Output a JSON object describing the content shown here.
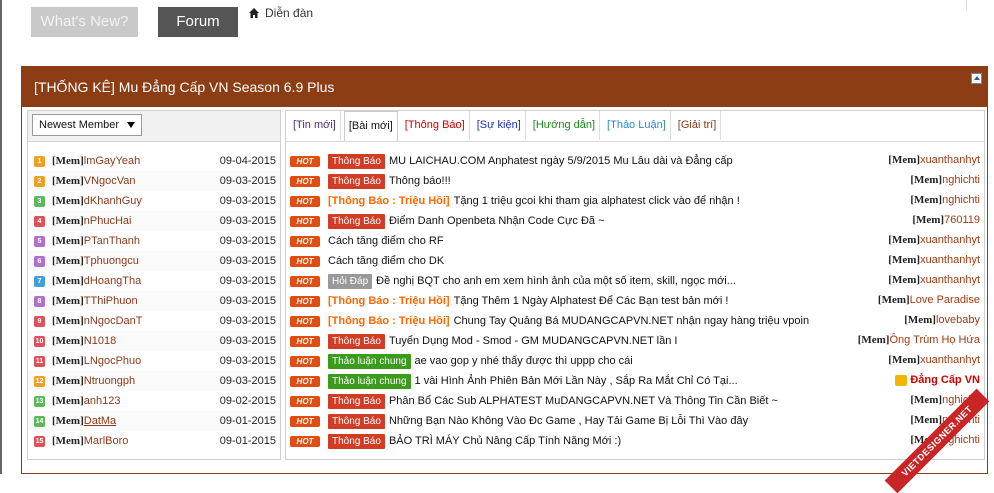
{
  "nav": {
    "whats_new": "What's New?",
    "forum": "Forum",
    "breadcrumb": "Diễn đàn"
  },
  "panel": {
    "title": "[THỐNG KÊ] Mu Đẳng Cấp VN Season 6.9 Plus"
  },
  "member_select": {
    "selected": "Newest Member"
  },
  "tabs": [
    {
      "label": "[Tin mới]",
      "color": "#5a2a7a"
    },
    {
      "label": "[Bài mới]",
      "color": "#111111"
    },
    {
      "label": "[Thông Báo]",
      "color": "#cc0000"
    },
    {
      "label": "[Sự kiện]",
      "color": "#1a2fb5"
    },
    {
      "label": "[Hướng dẫn]",
      "color": "#1a8a1a"
    },
    {
      "label": "[Thảo Luận]",
      "color": "#2a8ad8"
    },
    {
      "label": "[Giải trí]",
      "color": "#8b3a1a"
    }
  ],
  "members": [
    {
      "rank": "1",
      "rank_color": "#f0a020",
      "tag": "[Mem]",
      "name": "lmGayYeah",
      "date": "09-04-2015"
    },
    {
      "rank": "2",
      "rank_color": "#f0a020",
      "tag": "[Mem]",
      "name": "VNgocVan",
      "date": "09-03-2015"
    },
    {
      "rank": "3",
      "rank_color": "#5cb85c",
      "tag": "[Mem]",
      "name": "dKhanhGuy",
      "date": "09-03-2015"
    },
    {
      "rank": "4",
      "rank_color": "#e0505a",
      "tag": "[Mem]",
      "name": "nPhucHai",
      "date": "09-03-2015"
    },
    {
      "rank": "5",
      "rank_color": "#b070d0",
      "tag": "[Mem]",
      "name": "PTanThanh",
      "date": "09-03-2015"
    },
    {
      "rank": "6",
      "rank_color": "#b070d0",
      "tag": "[Mem]",
      "name": "Tphuongcu",
      "date": "09-03-2015"
    },
    {
      "rank": "7",
      "rank_color": "#40a0d8",
      "tag": "[Mem]",
      "name": "dHoangTha",
      "date": "09-03-2015"
    },
    {
      "rank": "8",
      "rank_color": "#b070d0",
      "tag": "[Mem]",
      "name": "TThiPhuon",
      "date": "09-03-2015"
    },
    {
      "rank": "9",
      "rank_color": "#e0505a",
      "tag": "[Mem]",
      "name": "nNgocDanT",
      "date": "09-03-2015"
    },
    {
      "rank": "10",
      "rank_color": "#e0505a",
      "tag": "[Mem]",
      "name": "N1018",
      "date": "09-03-2015"
    },
    {
      "rank": "11",
      "rank_color": "#e0505a",
      "tag": "[Mem]",
      "name": "LNgocPhuo",
      "date": "09-03-2015"
    },
    {
      "rank": "12",
      "rank_color": "#f0a020",
      "tag": "[Mem]",
      "name": "Ntruongph",
      "date": "09-03-2015"
    },
    {
      "rank": "13",
      "rank_color": "#5cb85c",
      "tag": "[Mem]",
      "name": "anh123",
      "date": "09-02-2015"
    },
    {
      "rank": "14",
      "rank_color": "#5cb85c",
      "tag": "[Mem]",
      "name": "DatMa",
      "date": "09-01-2015"
    },
    {
      "rank": "15",
      "rank_color": "#e0505a",
      "tag": "[Mem]",
      "name": "MarlBoro",
      "date": "09-01-2015"
    }
  ],
  "threads": [
    {
      "hot": "HOT",
      "badge": "Thông Báo",
      "badge_type": "bred",
      "prefix": "",
      "title": "MU LAICHAU.COM Anphatest ngày 5/9/2015 Mu Lâu dài và Đẳng cấp",
      "tag": "[Mem]",
      "user": "xuanthanhyt"
    },
    {
      "hot": "HOT",
      "badge": "Thông Báo",
      "badge_type": "bred",
      "prefix": "",
      "title": "Thông báo!!!",
      "tag": "[Mem]",
      "user": "nghichti"
    },
    {
      "hot": "HOT",
      "badge": "",
      "badge_type": "",
      "prefix": "[Thông Báo : Triệu Hồi]",
      "title": "Tặng 1 triệu gcoi khi tham gia alphatest click vào để nhận !",
      "tag": "[Mem]",
      "user": "nghichti"
    },
    {
      "hot": "HOT",
      "badge": "Thông Báo",
      "badge_type": "bred",
      "prefix": "",
      "title": "Điểm Danh Openbeta Nhận Code Cực Đã ~",
      "tag": "[Mem]",
      "user": "760119"
    },
    {
      "hot": "HOT",
      "badge": "",
      "badge_type": "",
      "prefix": "",
      "title": "Cách tăng điểm cho RF",
      "tag": "[Mem]",
      "user": "xuanthanhyt"
    },
    {
      "hot": "HOT",
      "badge": "",
      "badge_type": "",
      "prefix": "",
      "title": "Cách tăng điểm cho DK",
      "tag": "[Mem]",
      "user": "xuanthanhyt"
    },
    {
      "hot": "HOT",
      "badge": "Hỏi Đáp",
      "badge_type": "bgray",
      "prefix": "",
      "title": "Đề nghị BQT cho anh em xem hình ảnh của một số item, skill, ngọc mới...",
      "tag": "[Mem]",
      "user": "xuanthanhyt"
    },
    {
      "hot": "HOT",
      "badge": "",
      "badge_type": "",
      "prefix": "[Thông Báo : Triệu Hồi]",
      "title": "Tặng Thêm 1 Ngày Alphatest Để Các Bạn test bản mới !",
      "tag": "[Mem]",
      "user": "Love Paradise"
    },
    {
      "hot": "HOT",
      "badge": "",
      "badge_type": "",
      "prefix": "[Thông Báo : Triệu Hồi]",
      "title": "Chung Tay Quảng Bá MUDANGCAPVN.NET nhận ngay hàng triệu vpoin",
      "tag": "[Mem]",
      "user": "lovebaby"
    },
    {
      "hot": "HOT",
      "badge": "Thông Báo",
      "badge_type": "bred",
      "prefix": "",
      "title": "Tuyển Dụng Mod - Smod - GM MUDANGCAPVN.NET lần I",
      "tag": "[Mem]",
      "user": "Ông Trùm Họ Hứa"
    },
    {
      "hot": "HOT",
      "badge": "Thảo luận chung",
      "badge_type": "bgreen",
      "prefix": "",
      "title": "ae vao gop y nhé thấy được thì uppp cho cái",
      "tag": "[Mem]",
      "user": "xuanthanhyt"
    },
    {
      "hot": "HOT",
      "badge": "Thảo luận chung",
      "badge_type": "bgreen",
      "prefix": "",
      "title": "1 vài Hình Ảnh Phiên Bản Mới Lần Này , Sắp Ra Mắt Chỉ Có Tại...",
      "tag": "",
      "user": "Đẳng Cấp VN"
    },
    {
      "hot": "HOT",
      "badge": "Thông Báo",
      "badge_type": "bred",
      "prefix": "",
      "title": "Phân Bổ Các Sub ALPHATEST MuDANGCAPVN.NET Và Thông Tin Cần Biết ~",
      "tag": "[Mem]",
      "user": "nghichti"
    },
    {
      "hot": "HOT",
      "badge": "Thông Báo",
      "badge_type": "bred",
      "prefix": "",
      "title": "Những Bạn Nào Không Vào Đc Game , Hay Tải Game Bị Lỗi Thì Vào đây",
      "tag": "[Mem]",
      "user": "nghichti"
    },
    {
      "hot": "HOT",
      "badge": "Thông Báo",
      "badge_type": "bred",
      "prefix": "",
      "title": "BẢO TRÌ MÁY Chủ Nâng Cấp Tính Năng Mới :)",
      "tag": "[Mem]",
      "user": "nghichti"
    }
  ],
  "watermark": "VIETDESIGNER.NET"
}
